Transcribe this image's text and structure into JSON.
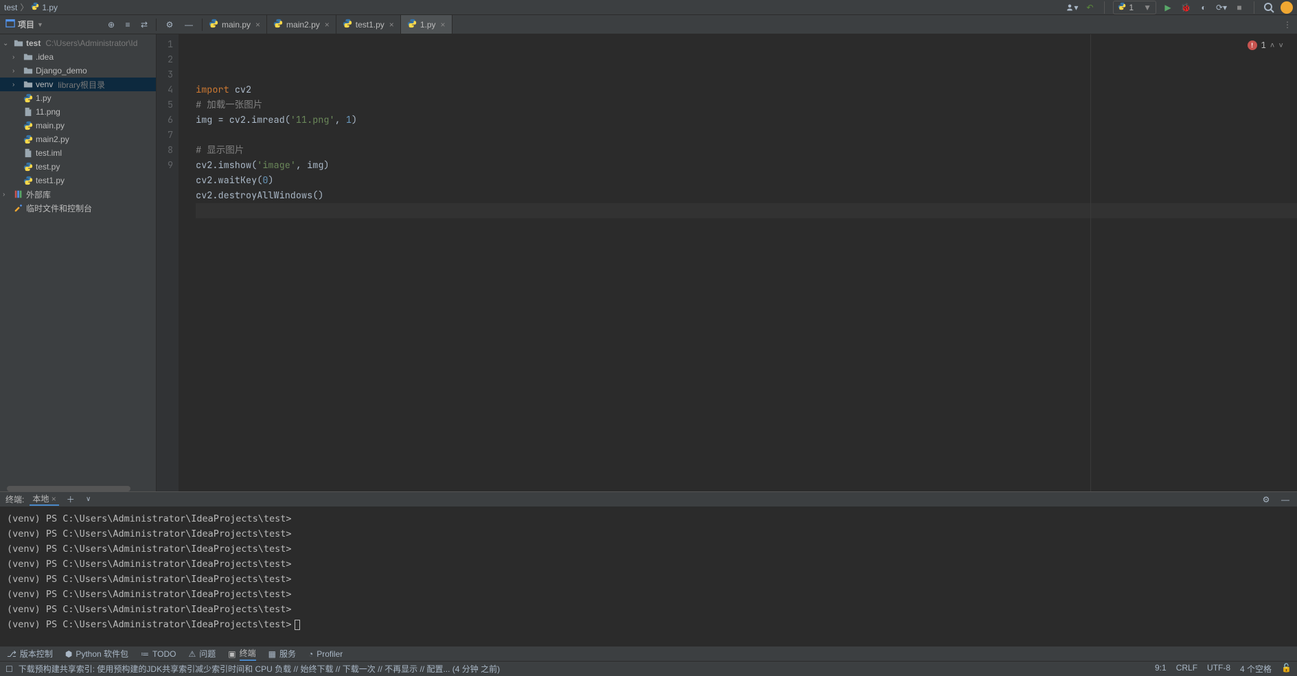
{
  "breadcrumb": {
    "root": "test",
    "file": "1.py"
  },
  "runConfig": {
    "name": "1"
  },
  "projectHeader": {
    "label": "项目"
  },
  "tree": {
    "root": {
      "name": "test",
      "path": "C:\\Users\\Administrator\\Id"
    },
    "children": [
      {
        "name": ".idea",
        "type": "folder",
        "indent": 2,
        "expandable": true
      },
      {
        "name": "Django_demo",
        "type": "folder",
        "indent": 2,
        "expandable": true
      },
      {
        "name": "venv",
        "suffix": "library根目录",
        "type": "folder",
        "indent": 2,
        "selected": true,
        "expandable": true
      },
      {
        "name": "1.py",
        "type": "py",
        "indent": 2
      },
      {
        "name": "11.png",
        "type": "file",
        "indent": 2
      },
      {
        "name": "main.py",
        "type": "py",
        "indent": 2
      },
      {
        "name": "main2.py",
        "type": "py",
        "indent": 2
      },
      {
        "name": "test.iml",
        "type": "file",
        "indent": 2
      },
      {
        "name": "test.py",
        "type": "py",
        "indent": 2
      },
      {
        "name": "test1.py",
        "type": "py",
        "indent": 2
      }
    ],
    "external": "外部库",
    "scratches": "临时文件和控制台"
  },
  "tabs": [
    {
      "label": "main.py",
      "active": false
    },
    {
      "label": "main2.py",
      "active": false
    },
    {
      "label": "test1.py",
      "active": false
    },
    {
      "label": "1.py",
      "active": true
    }
  ],
  "code": {
    "lines": [
      {
        "n": 1,
        "html": "<span class='kw'>import </span><span class='fn'>cv2</span>"
      },
      {
        "n": 2,
        "html": "<span class='cmt'># 加载一张图片</span>"
      },
      {
        "n": 3,
        "html": "img = cv2.imread(<span class='str'>'11.png'</span>, <span class='num'>1</span>)"
      },
      {
        "n": 4,
        "html": ""
      },
      {
        "n": 5,
        "html": "<span class='cmt'># 显示图片</span>"
      },
      {
        "n": 6,
        "html": "cv2.imshow(<span class='str'>'image'</span>, img)"
      },
      {
        "n": 7,
        "html": "cv2.waitKey(<span class='num'>0</span>)"
      },
      {
        "n": 8,
        "html": "cv2.destroyAllWindows()"
      },
      {
        "n": 9,
        "html": "",
        "current": true
      }
    ],
    "errorCount": "1"
  },
  "terminal": {
    "title": "终端:",
    "tab": "本地",
    "prompt": "(venv) PS C:\\Users\\Administrator\\IdeaProjects\\test>",
    "lineCount": 8
  },
  "bottomTabs": {
    "vcs": "版本控制",
    "packages": "Python 软件包",
    "todo": "TODO",
    "problems": "问题",
    "terminal": "终端",
    "services": "服务",
    "profiler": "Profiler"
  },
  "statusBar": {
    "message": "下载预构建共享索引: 使用预构建的JDK共享索引减少索引时间和 CPU 负载 // 始终下载 // 下载一次 // 不再显示 // 配置... (4 分钟 之前)",
    "cursor": "9:1",
    "lineEnding": "CRLF",
    "encoding": "UTF-8",
    "indent": "4 个空格"
  }
}
